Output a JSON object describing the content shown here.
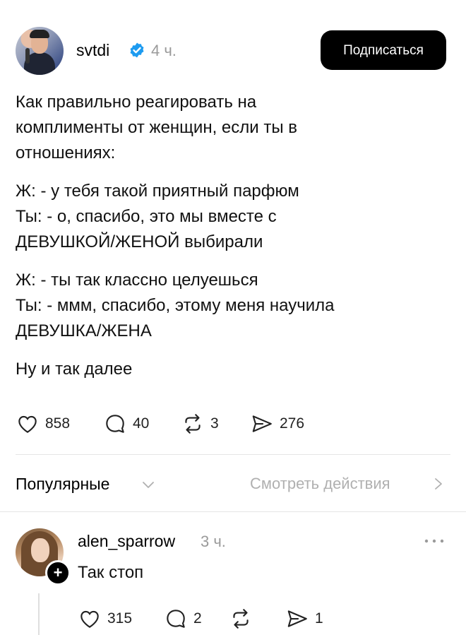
{
  "post": {
    "username": "svtdi",
    "time": "4 ч.",
    "subscribe_label": "Подписаться",
    "paragraphs": [
      [
        "Как правильно реагировать на",
        "комплименты от женщин, если ты в",
        "отношениях:"
      ],
      [
        "Ж: - у тебя такой приятный парфюм",
        "Ты: - о, спасибо, это мы вместе с",
        "ДЕВУШКОЙ/ЖЕНОЙ выбирали"
      ],
      [
        "Ж: - ты так классно целуешься",
        "Ты: - ммм, спасибо, этому меня научила",
        "ДЕВУШКА/ЖЕНА"
      ],
      [
        "Ну и так далее"
      ]
    ],
    "likes": "858",
    "comments": "40",
    "reposts": "3",
    "shares": "276"
  },
  "sort": {
    "label": "Популярные",
    "view_actions": "Смотреть действия"
  },
  "comment": {
    "username": "alen_sparrow",
    "time": "3 ч.",
    "text": "Так стоп",
    "likes": "315",
    "comments": "2",
    "shares": "1"
  },
  "colors": {
    "verified": "#1d9bf0",
    "muted": "#9a9a9a",
    "button_bg": "#000000"
  },
  "icons": [
    "verified-icon",
    "heart-icon",
    "comment-icon",
    "repost-icon",
    "share-icon",
    "chevron-down-icon",
    "chevron-right-icon",
    "more-icon",
    "plus-icon"
  ]
}
